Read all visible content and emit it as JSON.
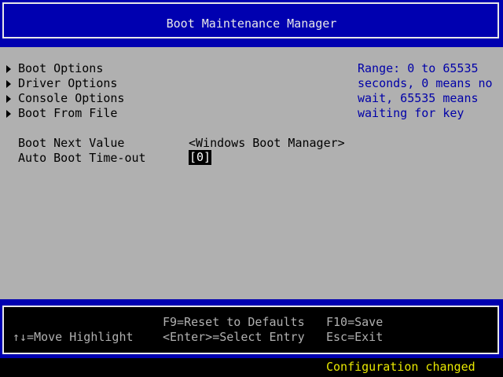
{
  "header": {
    "title": "Boot Maintenance Manager"
  },
  "menu": {
    "items": [
      {
        "label": "Boot Options"
      },
      {
        "label": "Driver Options"
      },
      {
        "label": "Console Options"
      },
      {
        "label": "Boot From File"
      }
    ]
  },
  "settings": {
    "boot_next_label": "Boot Next Value",
    "boot_next_value": "<Windows Boot Manager>",
    "auto_boot_label": "Auto Boot Time-out",
    "auto_boot_value": "[0]"
  },
  "help": {
    "lines": [
      "Range: 0 to 65535",
      "seconds, 0 means no",
      "wait, 65535 means",
      "waiting for key"
    ]
  },
  "footer": {
    "move_highlight": "↑↓=Move Highlight",
    "reset_defaults": "F9=Reset to Defaults",
    "select_entry": "<Enter>=Select Entry",
    "save": "F10=Save",
    "exit": "Esc=Exit"
  },
  "status": {
    "message": "Configuration changed"
  },
  "colors": {
    "background": "#b0b0b0",
    "header_blue": "#0000b0",
    "help_text": "#0000a8",
    "status_text": "#e8e800"
  }
}
